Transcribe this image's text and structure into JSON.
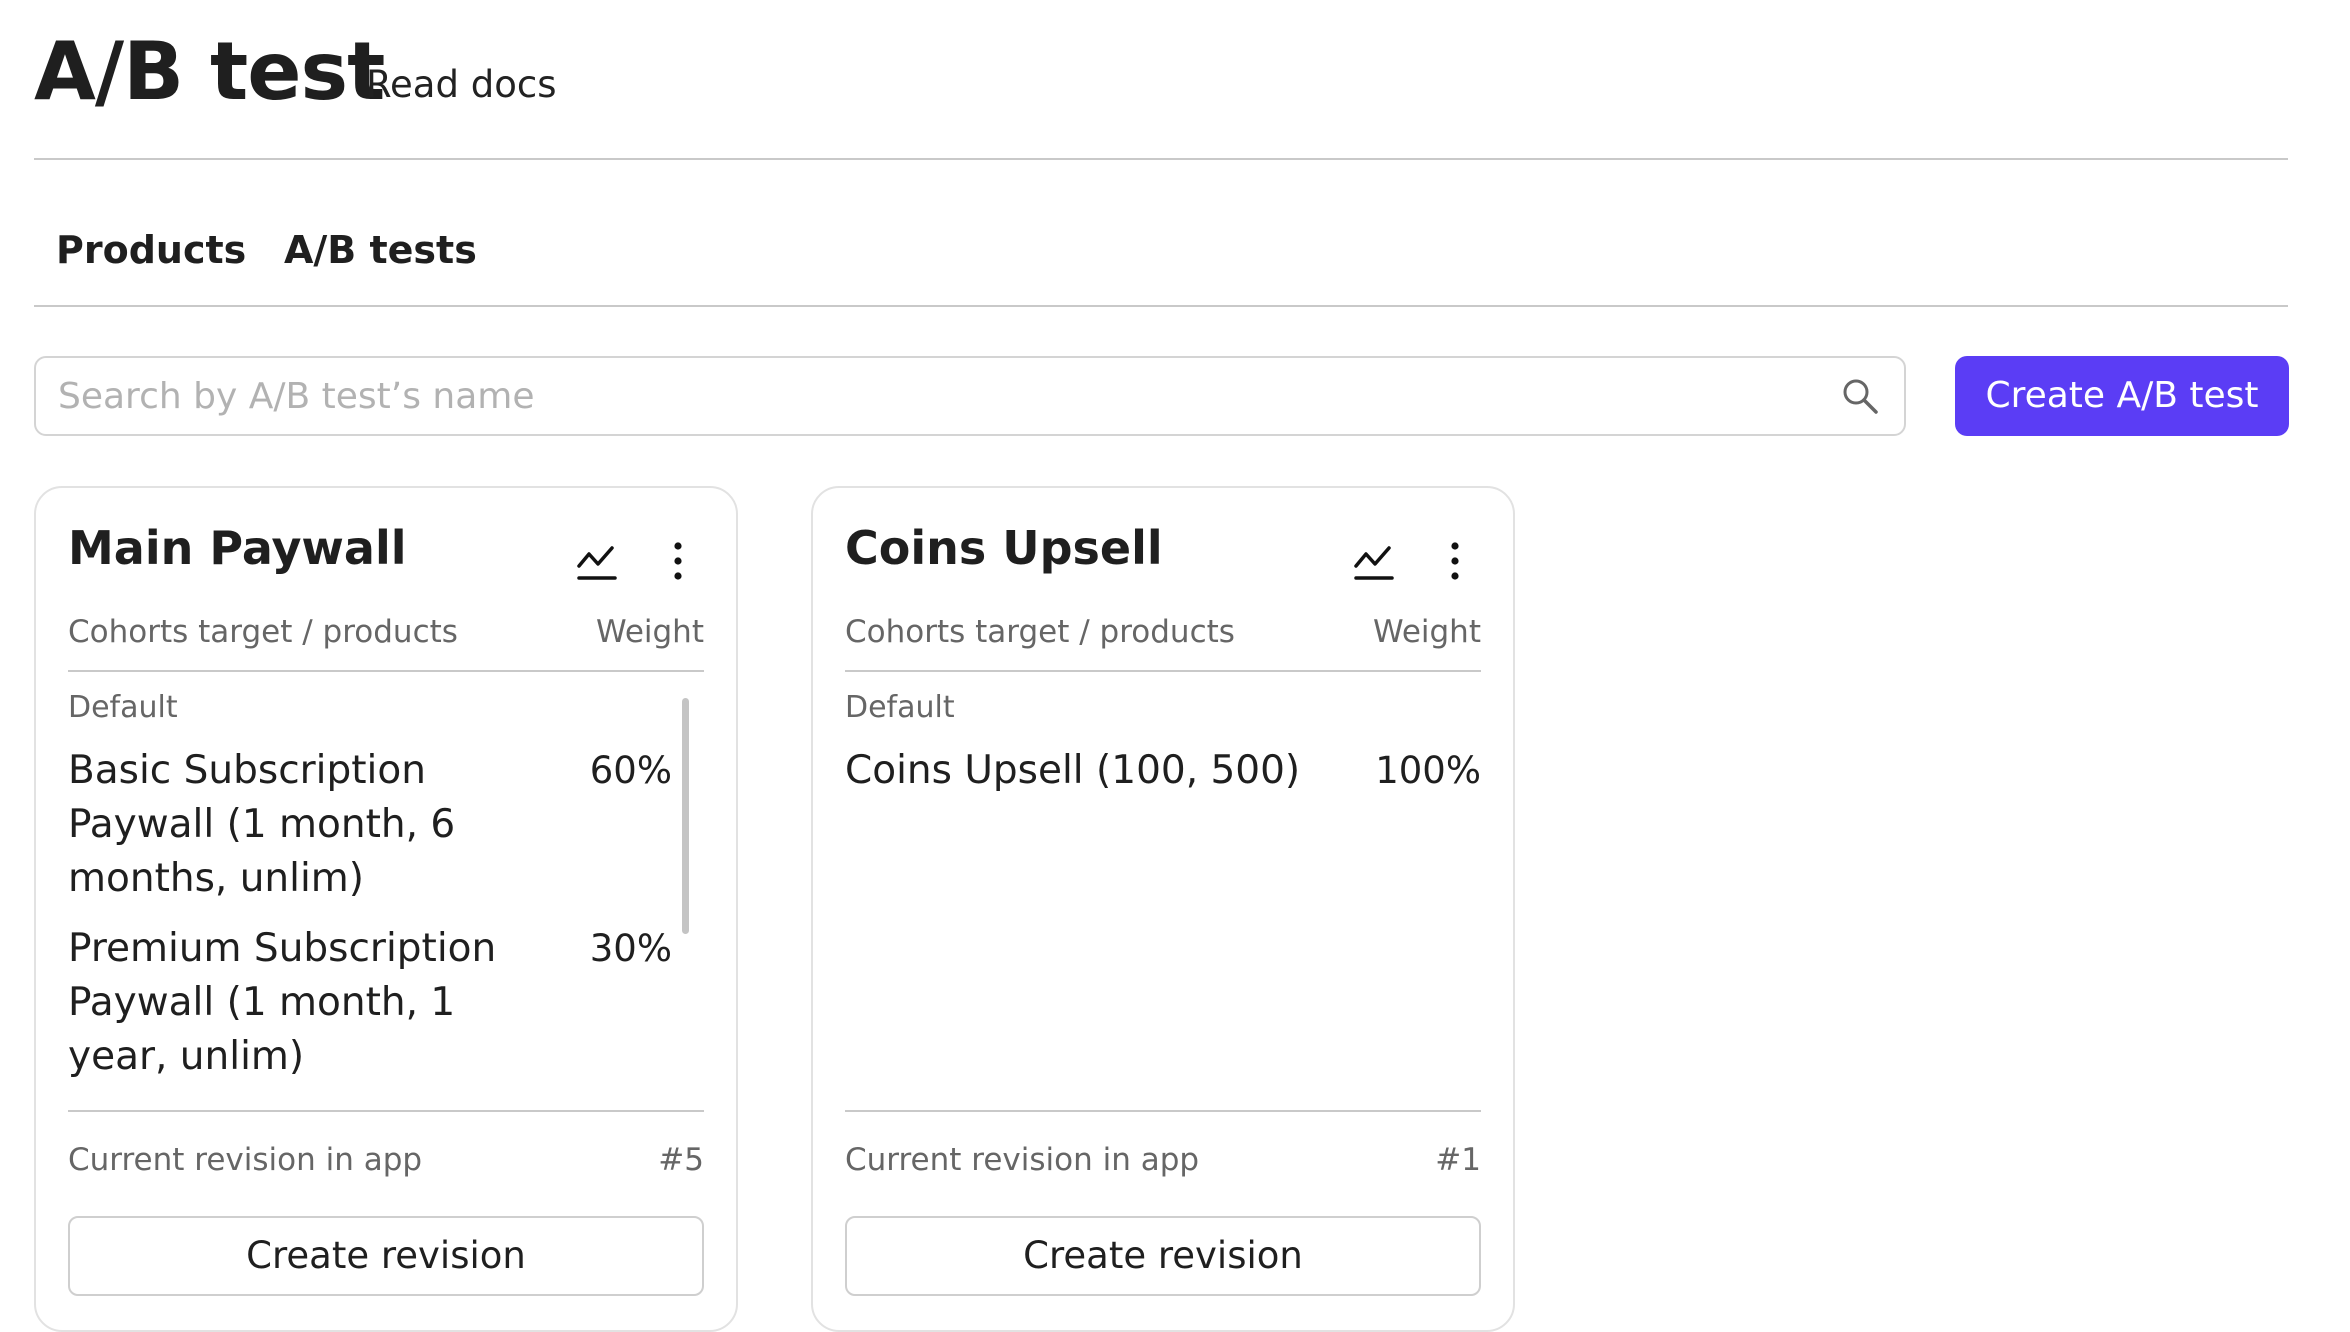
{
  "header": {
    "title": "A/B test",
    "docs_link": "Read docs"
  },
  "tabs": [
    {
      "label": "Products"
    },
    {
      "label": "A/B tests"
    }
  ],
  "search": {
    "placeholder": "Search by A/B test’s name",
    "value": ""
  },
  "create_button": "Create A/B test",
  "colors": {
    "accent": "#5b3df5",
    "divider": "#c9c9c9",
    "muted_text": "#666666"
  },
  "cards": [
    {
      "title": "Main Paywall",
      "col_left": "Cohorts target / products",
      "col_right": "Weight",
      "cohort": "Default",
      "rows": [
        {
          "name": "Basic Subscription Paywall (1 month, 6 months, unlim)",
          "weight": "60%"
        },
        {
          "name": "Premium Subscription Paywall (1 month, 1 year, unlim)",
          "weight": "30%"
        }
      ],
      "revision_label": "Current revision in app",
      "revision_number": "#5",
      "revision_button": "Create revision"
    },
    {
      "title": "Coins Upsell",
      "col_left": "Cohorts target / products",
      "col_right": "Weight",
      "cohort": "Default",
      "rows": [
        {
          "name": "Coins Upsell (100, 500)",
          "weight": "100%"
        }
      ],
      "revision_label": "Current revision in app",
      "revision_number": "#1",
      "revision_button": "Create revision"
    }
  ],
  "icons": {
    "search": "search-icon",
    "stats": "chart-line-icon",
    "more": "more-vertical-icon"
  }
}
